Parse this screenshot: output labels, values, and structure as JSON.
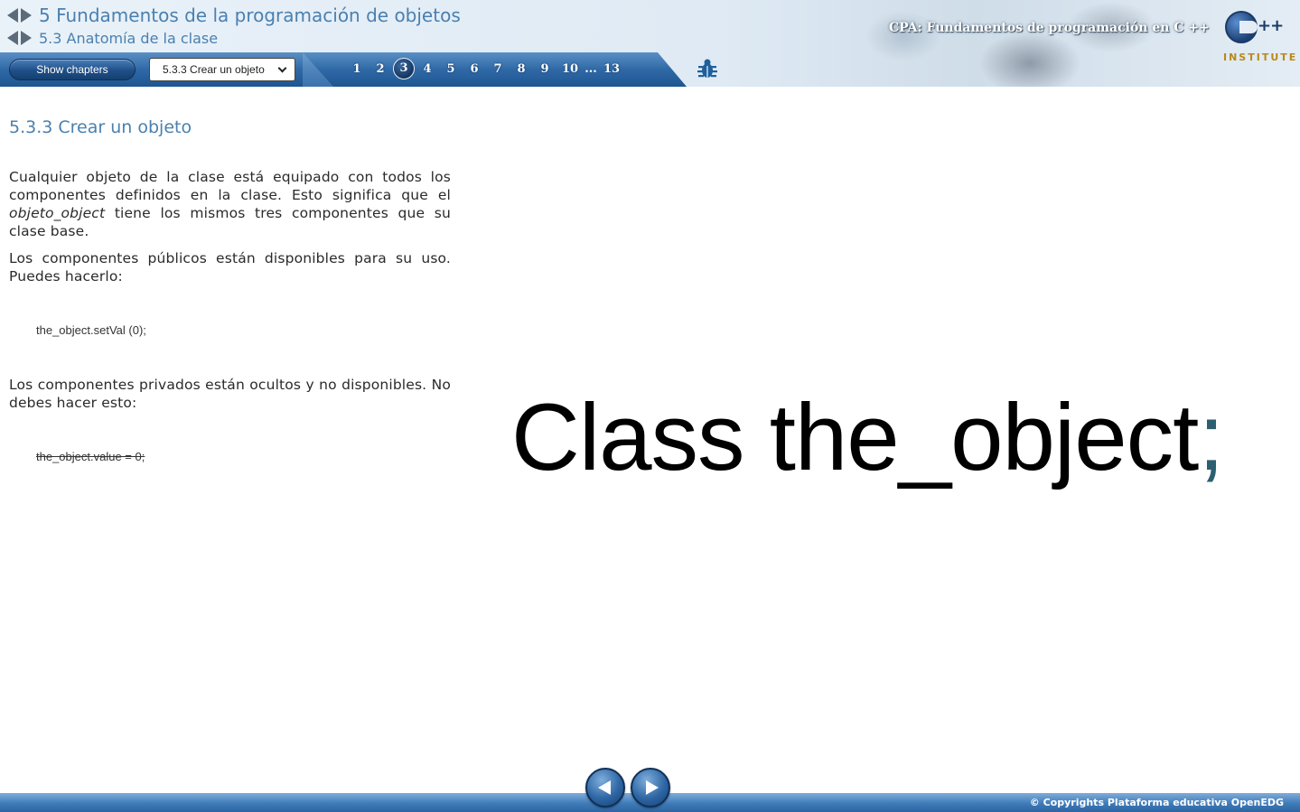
{
  "header": {
    "chapter_title": "5 Fundamentos de la programación de objetos",
    "section_title": "5.3 Anatomía de la clase",
    "course_title": "CPA: Fundamentos de programación en C ++",
    "logo": {
      "main": "C++",
      "sub": "INSTITUTE"
    }
  },
  "toolbar": {
    "show_chapters_label": "Show chapters",
    "subsection_selected": "5.3.3 Crear un objeto",
    "pages": [
      "1",
      "2",
      "3",
      "4",
      "5",
      "6",
      "7",
      "8",
      "9",
      "10"
    ],
    "ellipsis": "...",
    "last_page": "13",
    "current_page": "3",
    "bug_icon": "bug-report-icon"
  },
  "content": {
    "title": "5.3.3 Crear un objeto",
    "paragraph1_before": "Cualquier objeto de la clase está equipado con todos los componentes definidos en la clase. Esto significa que el ",
    "paragraph1_italic": "objeto_object",
    "paragraph1_after": " tiene los mismos tres componentes que su clase base.",
    "paragraph2": "Los componentes públicos están disponibles para su uso. Puedes hacerlo:",
    "code1": "the_object.setVal (0);",
    "paragraph3": "Los componentes privados están ocultos y no disponibles. No debes hacer esto:",
    "code2": "the_object.value = 0;",
    "big_code_text": "Class the_object",
    "big_code_semicolon": ";"
  },
  "footer": {
    "copyright": "© Copyrights Plataforma educativa OpenEDG",
    "prev_icon": "previous-arrow-icon",
    "next_icon": "next-arrow-icon"
  },
  "colors": {
    "title_blue": "#4a80b0",
    "toolbar_blue": "#2f69a6",
    "semicolon": "#2d5f72"
  }
}
